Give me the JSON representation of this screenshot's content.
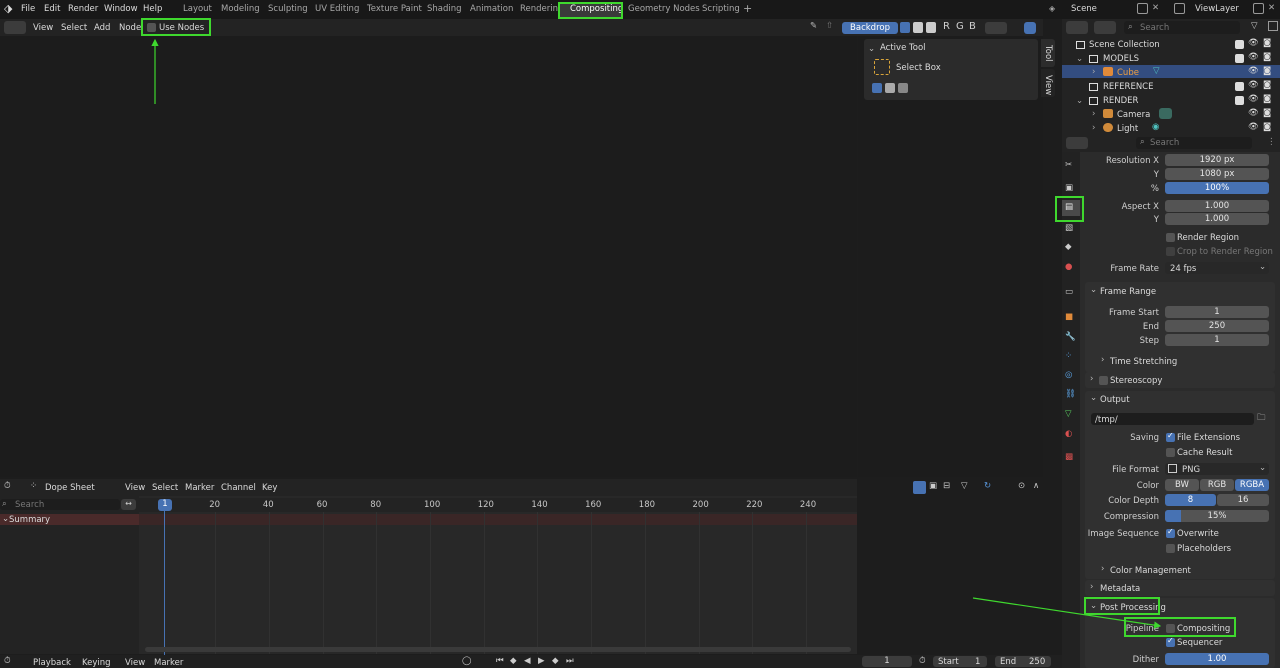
{
  "topbar": {
    "menus": [
      "File",
      "Edit",
      "Render",
      "Window",
      "Help"
    ],
    "workspaces": [
      "Layout",
      "Modeling",
      "Sculpting",
      "UV Editing",
      "Texture Paint",
      "Shading",
      "Animation",
      "Rendering",
      "Compositing",
      "Geometry Nodes",
      "Scripting"
    ],
    "active_workspace": "Compositing",
    "add_tab": "+",
    "scene": "Scene",
    "view_layer": "ViewLayer"
  },
  "compositor": {
    "menus": [
      "View",
      "Select",
      "Add",
      "Node"
    ],
    "use_nodes_label": "Use Nodes",
    "backdrop_label": "Backdrop",
    "channels": [
      "R",
      "G",
      "B"
    ],
    "npanel": {
      "title": "Active Tool",
      "tool": "Select Box",
      "tabs": [
        "Tool",
        "View"
      ]
    }
  },
  "outliner": {
    "search_placeholder": "Search",
    "rows": [
      {
        "label": "Scene Collection"
      },
      {
        "label": "MODELS"
      },
      {
        "label": "Cube"
      },
      {
        "label": "REFERENCE"
      },
      {
        "label": "RENDER"
      },
      {
        "label": "Camera"
      },
      {
        "label": "Light"
      }
    ]
  },
  "properties": {
    "search_placeholder": "Search",
    "format": {
      "resolution_x_label": "Resolution X",
      "resolution_x": "1920 px",
      "y_label": "Y",
      "resolution_y": "1080 px",
      "percent_label": "%",
      "percent": "100%",
      "aspect_x_label": "Aspect X",
      "aspect_x": "1.000",
      "aspect_y_label": "Y",
      "aspect_y": "1.000",
      "render_region": "Render Region",
      "crop_region": "Crop to Render Region",
      "frame_rate_label": "Frame Rate",
      "frame_rate": "24 fps"
    },
    "frame_range": {
      "title": "Frame Range",
      "start_label": "Frame Start",
      "start": "1",
      "end_label": "End",
      "end": "250",
      "step_label": "Step",
      "step": "1",
      "time_stretching": "Time Stretching"
    },
    "stereoscopy": "Stereoscopy",
    "output": {
      "title": "Output",
      "path": "/tmp/",
      "saving_label": "Saving",
      "file_extensions": "File Extensions",
      "cache_result": "Cache Result",
      "file_format_label": "File Format",
      "file_format": "PNG",
      "color_label": "Color",
      "color_options": [
        "BW",
        "RGB",
        "RGBA"
      ],
      "color_selected": "RGBA",
      "color_depth_label": "Color Depth",
      "color_depth_options": [
        "8",
        "16"
      ],
      "color_depth_selected": "8",
      "compression_label": "Compression",
      "compression": "15%",
      "compression_fraction": 0.15,
      "image_sequence_label": "Image Sequence",
      "overwrite": "Overwrite",
      "placeholders": "Placeholders",
      "color_management": "Color Management"
    },
    "metadata": "Metadata",
    "post_processing": {
      "title": "Post Processing",
      "pipeline_label": "Pipeline",
      "compositing": "Compositing",
      "sequencer": "Sequencer",
      "dither_label": "Dither",
      "dither": "1.00"
    }
  },
  "dopesheet": {
    "mode": "Dope Sheet",
    "menus": [
      "View",
      "Select",
      "Marker",
      "Channel",
      "Key"
    ],
    "search_placeholder": "Search",
    "summary": "Summary",
    "current_frame": "1",
    "ticks": [
      "20",
      "40",
      "60",
      "80",
      "100",
      "120",
      "140",
      "160",
      "180",
      "200",
      "220",
      "240"
    ]
  },
  "timeline": {
    "menus": [
      "Playback",
      "Keying",
      "View",
      "Marker"
    ],
    "current_frame": "1",
    "start_label": "Start",
    "start": "1",
    "end_label": "End",
    "end": "250"
  },
  "colors": {
    "highlight": "#3fd82e",
    "accent": "#4772b3",
    "arrow": "#3fd82e"
  }
}
